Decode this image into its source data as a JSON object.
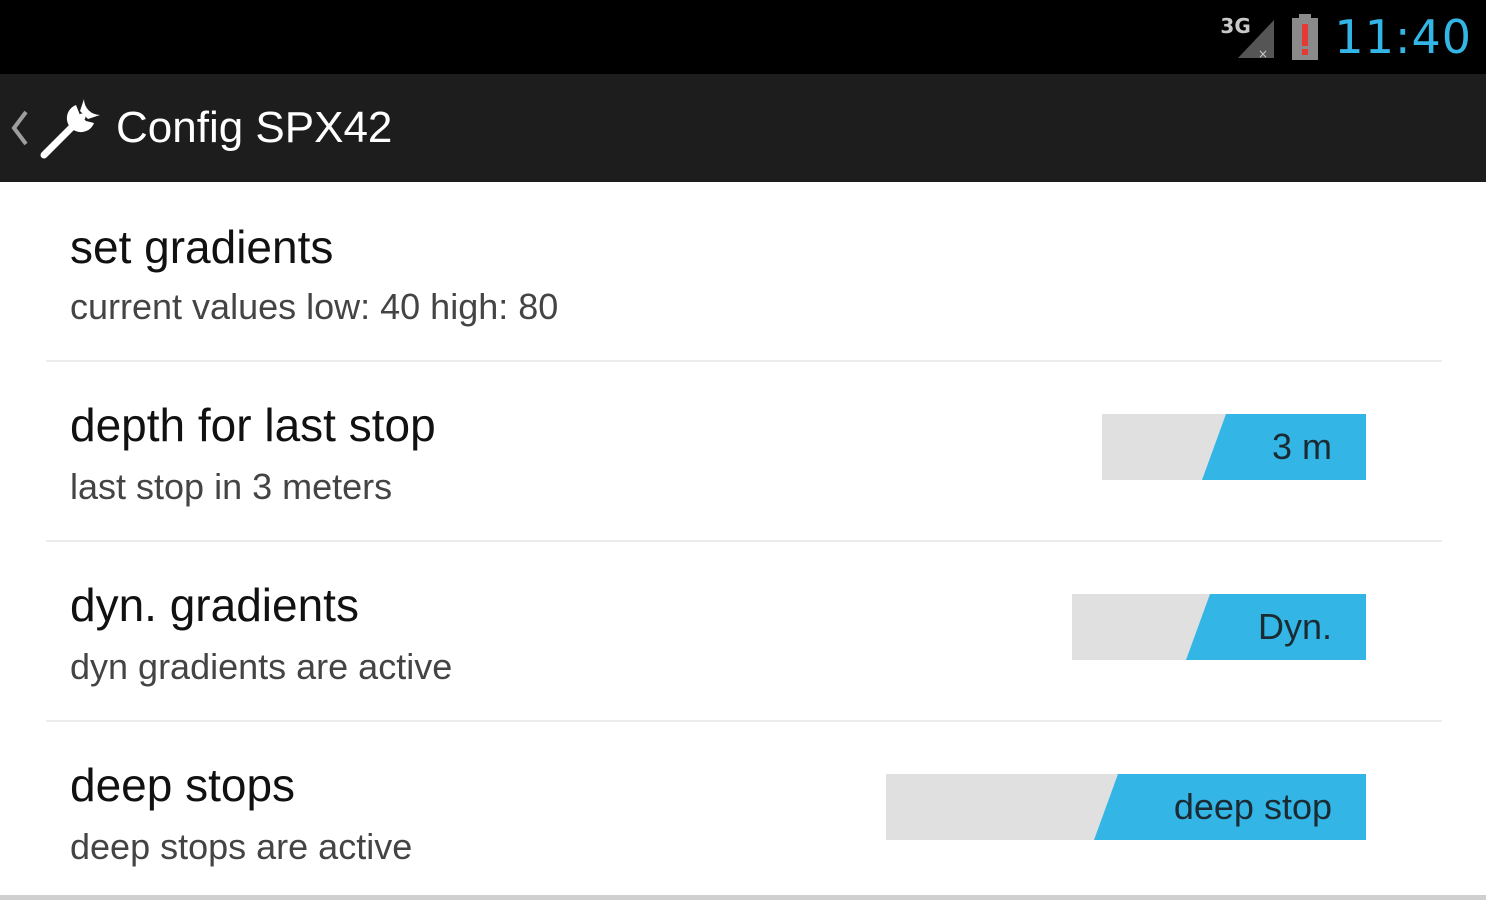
{
  "status_bar": {
    "network_label": "3G",
    "time": "11:40",
    "colors": {
      "clock": "#33b5e5",
      "battery_alert": "#e53935"
    }
  },
  "action_bar": {
    "title": "Config SPX42",
    "icon": "wrench-icon"
  },
  "preferences": [
    {
      "title": "set gradients",
      "summary": "current values low: 40 high: 80"
    },
    {
      "title": "depth for last stop",
      "summary": "last stop in 3 meters",
      "toggle_label": "3 m",
      "toggle_on": true
    },
    {
      "title": "dyn. gradients",
      "summary": "dyn gradients are active",
      "toggle_label": "Dyn.",
      "toggle_on": true
    },
    {
      "title": "deep stops",
      "summary": "deep stops are active",
      "toggle_label": "deep stop",
      "toggle_on": true
    }
  ],
  "colors": {
    "accent": "#33b5e5",
    "toggle_track": "#e0e0e0",
    "action_bar": "#1d1d1d"
  }
}
